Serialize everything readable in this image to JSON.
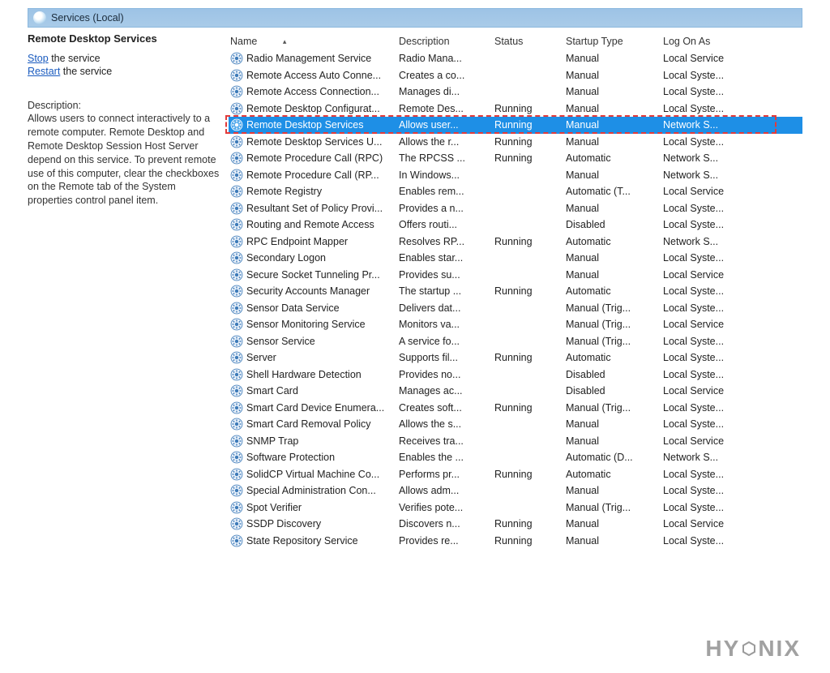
{
  "titlebar": {
    "title": "Services (Local)"
  },
  "panel": {
    "heading": "Remote Desktop Services",
    "stop_label": "Stop",
    "stop_suffix": " the service",
    "restart_label": "Restart",
    "restart_suffix": " the service",
    "desc_label": "Description:",
    "desc_text": "Allows users to connect interactively to a remote computer. Remote Desktop and Remote Desktop Session Host Server depend on this service. To prevent remote use of this computer, clear the checkboxes on the Remote tab of the System properties control panel item."
  },
  "columns": {
    "name": "Name",
    "description": "Description",
    "status": "Status",
    "startup": "Startup Type",
    "logon": "Log On As"
  },
  "selected_index": 4,
  "services": [
    {
      "name": "Radio Management Service",
      "desc": "Radio Mana...",
      "status": "",
      "startup": "Manual",
      "logon": "Local Service"
    },
    {
      "name": "Remote Access Auto Conne...",
      "desc": "Creates a co...",
      "status": "",
      "startup": "Manual",
      "logon": "Local Syste..."
    },
    {
      "name": "Remote Access Connection...",
      "desc": "Manages di...",
      "status": "",
      "startup": "Manual",
      "logon": "Local Syste..."
    },
    {
      "name": "Remote Desktop Configurat...",
      "desc": "Remote Des...",
      "status": "Running",
      "startup": "Manual",
      "logon": "Local Syste..."
    },
    {
      "name": "Remote Desktop Services",
      "desc": "Allows user...",
      "status": "Running",
      "startup": "Manual",
      "logon": "Network S..."
    },
    {
      "name": "Remote Desktop Services U...",
      "desc": "Allows the r...",
      "status": "Running",
      "startup": "Manual",
      "logon": "Local Syste..."
    },
    {
      "name": "Remote Procedure Call (RPC)",
      "desc": "The RPCSS ...",
      "status": "Running",
      "startup": "Automatic",
      "logon": "Network S..."
    },
    {
      "name": "Remote Procedure Call (RP...",
      "desc": "In Windows...",
      "status": "",
      "startup": "Manual",
      "logon": "Network S..."
    },
    {
      "name": "Remote Registry",
      "desc": "Enables rem...",
      "status": "",
      "startup": "Automatic (T...",
      "logon": "Local Service"
    },
    {
      "name": "Resultant Set of Policy Provi...",
      "desc": "Provides a n...",
      "status": "",
      "startup": "Manual",
      "logon": "Local Syste..."
    },
    {
      "name": "Routing and Remote Access",
      "desc": "Offers routi...",
      "status": "",
      "startup": "Disabled",
      "logon": "Local Syste..."
    },
    {
      "name": "RPC Endpoint Mapper",
      "desc": "Resolves RP...",
      "status": "Running",
      "startup": "Automatic",
      "logon": "Network S..."
    },
    {
      "name": "Secondary Logon",
      "desc": "Enables star...",
      "status": "",
      "startup": "Manual",
      "logon": "Local Syste..."
    },
    {
      "name": "Secure Socket Tunneling Pr...",
      "desc": "Provides su...",
      "status": "",
      "startup": "Manual",
      "logon": "Local Service"
    },
    {
      "name": "Security Accounts Manager",
      "desc": "The startup ...",
      "status": "Running",
      "startup": "Automatic",
      "logon": "Local Syste..."
    },
    {
      "name": "Sensor Data Service",
      "desc": "Delivers dat...",
      "status": "",
      "startup": "Manual (Trig...",
      "logon": "Local Syste..."
    },
    {
      "name": "Sensor Monitoring Service",
      "desc": "Monitors va...",
      "status": "",
      "startup": "Manual (Trig...",
      "logon": "Local Service"
    },
    {
      "name": "Sensor Service",
      "desc": "A service fo...",
      "status": "",
      "startup": "Manual (Trig...",
      "logon": "Local Syste..."
    },
    {
      "name": "Server",
      "desc": "Supports fil...",
      "status": "Running",
      "startup": "Automatic",
      "logon": "Local Syste..."
    },
    {
      "name": "Shell Hardware Detection",
      "desc": "Provides no...",
      "status": "",
      "startup": "Disabled",
      "logon": "Local Syste..."
    },
    {
      "name": "Smart Card",
      "desc": "Manages ac...",
      "status": "",
      "startup": "Disabled",
      "logon": "Local Service"
    },
    {
      "name": "Smart Card Device Enumera...",
      "desc": "Creates soft...",
      "status": "Running",
      "startup": "Manual (Trig...",
      "logon": "Local Syste..."
    },
    {
      "name": "Smart Card Removal Policy",
      "desc": "Allows the s...",
      "status": "",
      "startup": "Manual",
      "logon": "Local Syste..."
    },
    {
      "name": "SNMP Trap",
      "desc": "Receives tra...",
      "status": "",
      "startup": "Manual",
      "logon": "Local Service"
    },
    {
      "name": "Software Protection",
      "desc": "Enables the ...",
      "status": "",
      "startup": "Automatic (D...",
      "logon": "Network S..."
    },
    {
      "name": "SolidCP Virtual Machine Co...",
      "desc": "Performs pr...",
      "status": "Running",
      "startup": "Automatic",
      "logon": "Local Syste..."
    },
    {
      "name": "Special Administration Con...",
      "desc": "Allows adm...",
      "status": "",
      "startup": "Manual",
      "logon": "Local Syste..."
    },
    {
      "name": "Spot Verifier",
      "desc": "Verifies pote...",
      "status": "",
      "startup": "Manual (Trig...",
      "logon": "Local Syste..."
    },
    {
      "name": "SSDP Discovery",
      "desc": "Discovers n...",
      "status": "Running",
      "startup": "Manual",
      "logon": "Local Service"
    },
    {
      "name": "State Repository Service",
      "desc": "Provides re...",
      "status": "Running",
      "startup": "Manual",
      "logon": "Local Syste..."
    }
  ],
  "watermark": "HYONIX"
}
